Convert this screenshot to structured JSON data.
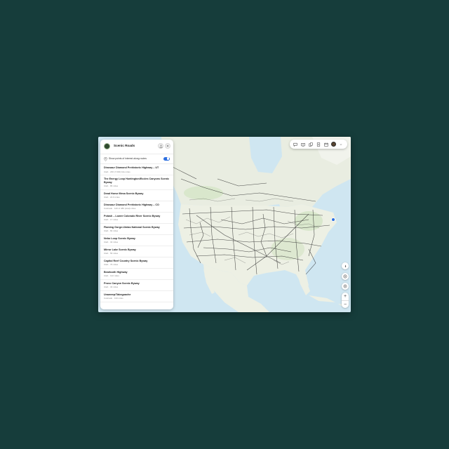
{
  "panel": {
    "title": "Scenic Roads",
    "toggle_label": "Show points of interest along routes",
    "toggle_on": true
  },
  "roads": [
    {
      "name": "Dinosaur Diamond Prehistoric Highway – UT",
      "meta": "Utah · 236 (7,000) bits miles"
    },
    {
      "name": "The Energy Loop Huntington/Eccles Canyons Scenic Byway",
      "meta": "Utah · 86 miles"
    },
    {
      "name": "Dead Horse Mesa Scenic Byway",
      "meta": "Utah · 22.9 miles"
    },
    {
      "name": "Dinosaur Diamond Prehistoric Highway – CO",
      "meta": "Colorado · 120 of 486 (total) miles"
    },
    {
      "name": "Potash – Lower Colorado River Scenic Byway",
      "meta": "Utah · 17 miles"
    },
    {
      "name": "Flaming Gorge-Uintas National Scenic Byway",
      "meta": "Utah · 82 miles"
    },
    {
      "name": "Nebo Loop Scenic Byway",
      "meta": "Utah · 32 miles"
    },
    {
      "name": "Mirror Lake Scenic Byway",
      "meta": "Utah · 56 miles"
    },
    {
      "name": "Capitol Reef Country Scenic Byway",
      "meta": "Utah · 76 miles"
    },
    {
      "name": "Beartooth Highway",
      "meta": "Utah · 122 miles"
    },
    {
      "name": "Provo Canyon Scenic Byway",
      "meta": "Utah · 34 miles"
    },
    {
      "name": "Unaweep/Tabeguache",
      "meta": "Colorado · 133 miles"
    }
  ],
  "toolbar": {
    "icons": [
      "chat-icon",
      "book-icon",
      "copy-icon",
      "document-icon",
      "calendar-icon",
      "avatar",
      "chevron-down-icon"
    ]
  },
  "map_controls": {
    "icons": [
      "compass-icon",
      "layers-icon",
      "location-icon"
    ],
    "zoom_in": "+",
    "zoom_out": "−"
  },
  "colors": {
    "background": "#163d3b",
    "water": "#cfe6f1",
    "land": "#edf0e4",
    "roads": "#2a2a2a",
    "accent": "#2d6fe0"
  }
}
